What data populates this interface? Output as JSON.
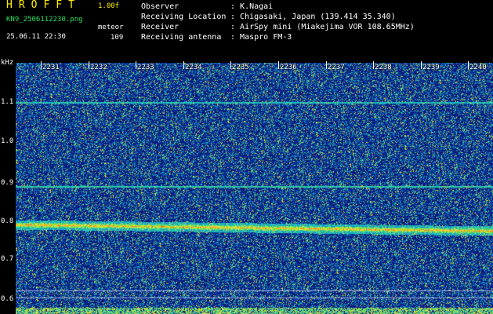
{
  "header": {
    "app_title": "HROFFT",
    "version": "1.00f",
    "filename": "KN9_2506112230.png",
    "datetime": "25.06.11 22:30",
    "count_label": "meteor",
    "count_value": "109",
    "info": [
      {
        "label": "Observer",
        "value": "K.Nagai"
      },
      {
        "label": "Receiving Location",
        "value": "Chigasaki, Japan (139.414 35.340)"
      },
      {
        "label": "Receiver",
        "value": "AirSpy mini (Miakejima VOR 108.65MHz)"
      },
      {
        "label": "Receiving antenna",
        "value": "Maspro FM-3"
      }
    ]
  },
  "y_axis": {
    "unit": "kHz",
    "ticks": [
      "1.1",
      "1.0",
      "0.9",
      "0.8",
      "0.7",
      "0.6"
    ]
  },
  "x_axis": {
    "ticks": [
      "2231",
      "2232",
      "2233",
      "2234",
      "2235",
      "2236",
      "2237",
      "2238",
      "2239",
      "2240"
    ]
  },
  "colors": {
    "background": "#000000",
    "header_title": "#ffef00",
    "header_accent": "#28e060",
    "spectrum_base": "#0a1a8c",
    "carrier": "#ff3030"
  }
}
